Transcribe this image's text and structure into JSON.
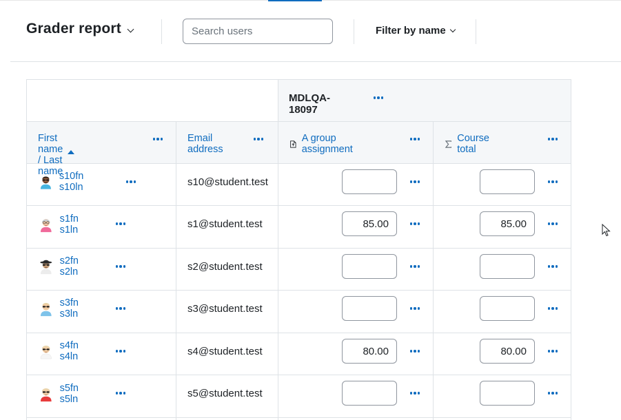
{
  "header": {
    "title": "Grader report",
    "search_placeholder": "Search users",
    "filter_label": "Filter by name"
  },
  "table": {
    "category": "MDLQA-18097",
    "columns": {
      "name": "First name / Last name",
      "email": "Email address",
      "assignment": "A group assignment",
      "total": "Course total"
    },
    "icons": {
      "sort": "sort-ascending-icon",
      "assignment": "assignment-icon",
      "total": "sigma-icon",
      "menu": "ellipsis-icon"
    },
    "rows": [
      {
        "name": "s10fn s10ln",
        "email": "s10@student.test",
        "assignment": "",
        "total": "",
        "avatar": {
          "skin": "#8d5a3b",
          "hair": "#2a1c14",
          "shirt": "#48b5e0",
          "hat": false,
          "glasses": true
        }
      },
      {
        "name": "s1fn s1ln",
        "email": "s1@student.test",
        "assignment": "85.00",
        "total": "85.00",
        "avatar": {
          "skin": "#f2c7a5",
          "hair": "#c9ccd1",
          "shirt": "#f06a9a",
          "hat": false,
          "glasses": true
        }
      },
      {
        "name": "s2fn s2ln",
        "email": "s2@student.test",
        "assignment": "",
        "total": "",
        "avatar": {
          "skin": "#c9a07a",
          "hair": "#2b2b2b",
          "shirt": "#ececec",
          "hat": true,
          "glasses": true
        }
      },
      {
        "name": "s3fn s3ln",
        "email": "s3@student.test",
        "assignment": "",
        "total": "",
        "avatar": {
          "skin": "#f2c9a0",
          "hair": "#e7d3a7",
          "shirt": "#7fc3ea",
          "hat": false,
          "glasses": true
        }
      },
      {
        "name": "s4fn s4ln",
        "email": "s4@student.test",
        "assignment": "80.00",
        "total": "80.00",
        "avatar": {
          "skin": "#f3cfa6",
          "hair": "#ead5ad",
          "shirt": "#f6f6f6",
          "hat": false,
          "glasses": true
        }
      },
      {
        "name": "s5fn s5ln",
        "email": "s5@student.test",
        "assignment": "",
        "total": "",
        "avatar": {
          "skin": "#f3cfa6",
          "hair": "#ead5ad",
          "shirt": "#e83b3b",
          "hat": false,
          "glasses": true
        }
      }
    ]
  }
}
